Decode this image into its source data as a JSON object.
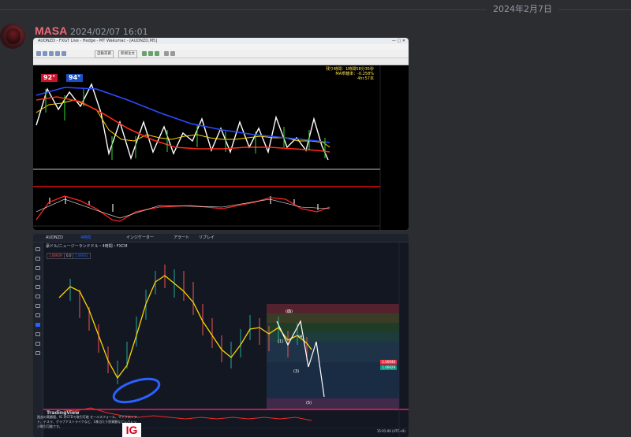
{
  "date_divider": "2024年2月7日",
  "message": {
    "username": "MASA",
    "timestamp": "2024/02/07 16:01",
    "username_color": "#f06a7a"
  },
  "mt4": {
    "titlebar": "AUDNZD - FXGT Live - Hedge - MT Wakumac - [AUDNZD,M5]",
    "menu": [
      "ファイル(F)",
      "表示(V)",
      "挿入(I)",
      "チャート(C)",
      "ツール(T)",
      "ウィンドウ(W)",
      "ヘルプ(H)"
    ],
    "toolbar_auto": "自動売買",
    "toolbar_order": "新規注文",
    "tag_box": "AUDNZD,M5",
    "badges": [
      {
        "label": "92°",
        "color": "#c8152b"
      },
      {
        "label": "94°",
        "color": "#1a4fbf"
      }
    ],
    "info": {
      "line1": "残り時間：1時間58分35秒",
      "line2": "MA乖離率：-0.258%",
      "line3": "4hr.57本"
    }
  },
  "tradingview": {
    "tab": "AUDNZD",
    "timeframe": "4時間",
    "indicators_label": "インジケーター",
    "alert_label": "アラート",
    "replay_label": "リプレイ",
    "symbol_title": "豪ドル/ニュージーランドドル・4時間・FXCM",
    "boxes": [
      "1.06929",
      "0.0",
      "1.06932"
    ],
    "elliott_labels": [
      "(1)",
      "(2)",
      "(3)",
      "(4)",
      "(5)"
    ],
    "brand": "TradingView",
    "news_text": "過去の実績値、IG のCFDで取引可能 セールスフォース、マイクロソフト、テスラ、グラブアストライクなど、1株当たり投資額などレバレッジ取引可能です。",
    "ig_logo": "IG",
    "footer": "15:01:00 (UTC+9)",
    "price_tags": [
      {
        "label": "1.06940",
        "color": "#f23645"
      },
      {
        "label": "1.06929",
        "color": "#089981"
      }
    ],
    "accent": "#2962ff"
  }
}
